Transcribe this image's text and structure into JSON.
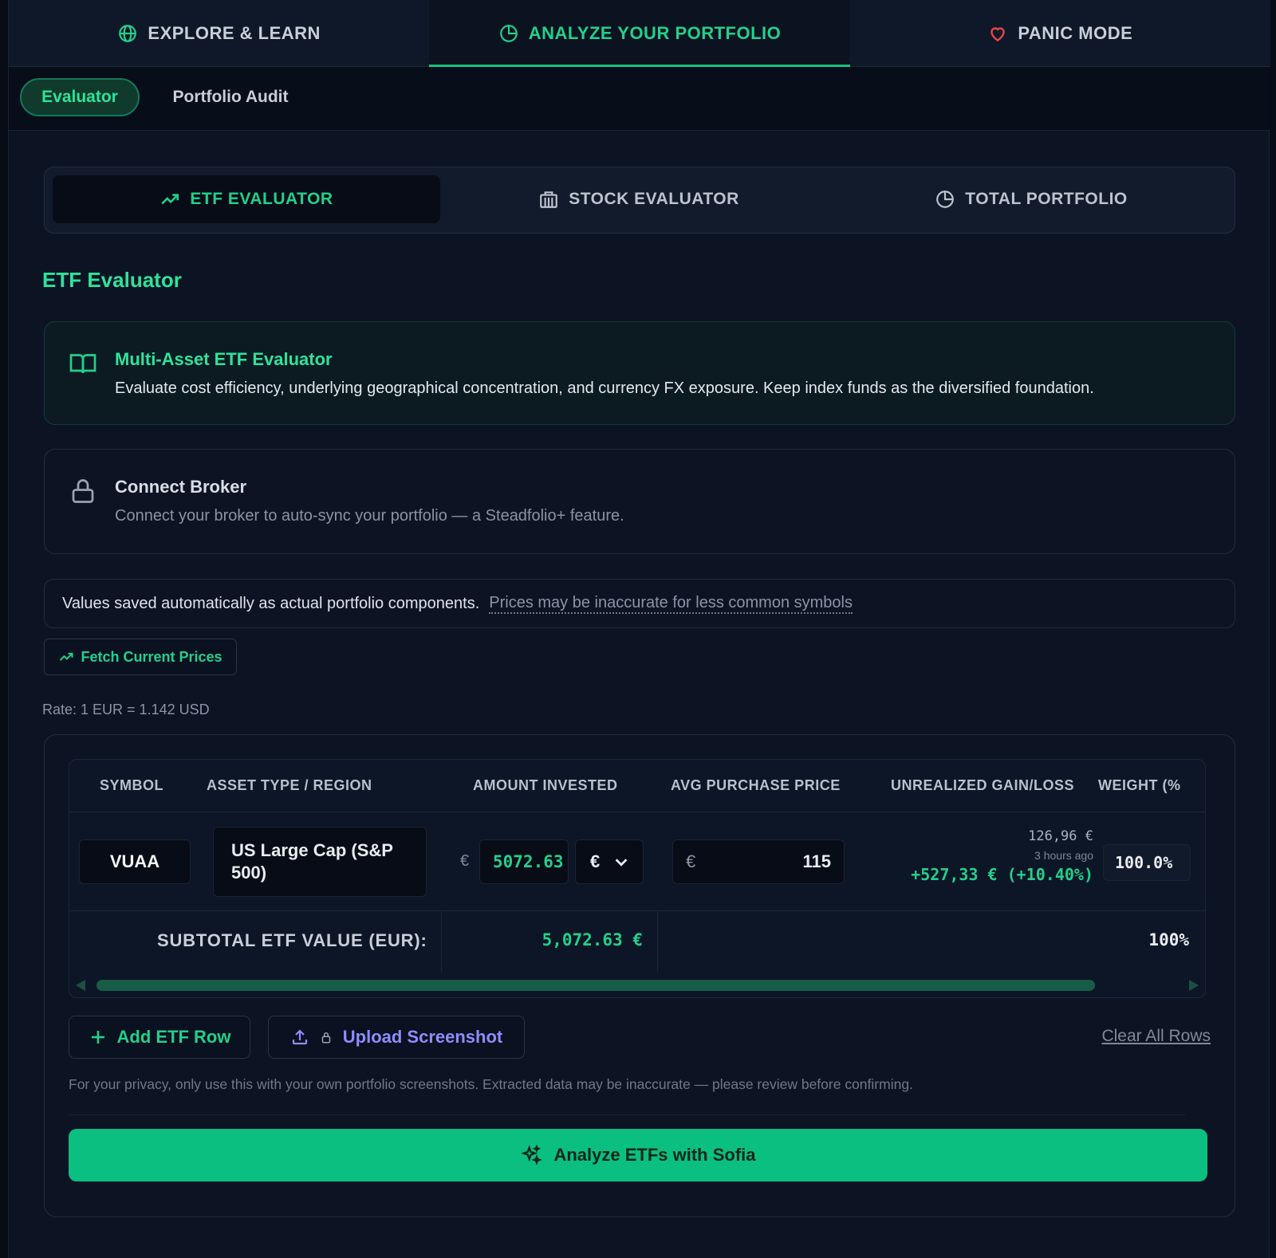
{
  "top_tabs": [
    {
      "label": "EXPLORE & LEARN",
      "icon": "globe-icon"
    },
    {
      "label": "ANALYZE YOUR PORTFOLIO",
      "icon": "pie-chart-icon",
      "active": true
    },
    {
      "label": "PANIC MODE",
      "icon": "heart-icon"
    }
  ],
  "sub_tabs": [
    {
      "label": "Evaluator",
      "active": true
    },
    {
      "label": "Portfolio Audit"
    }
  ],
  "eval_tabs": [
    {
      "label": "ETF EVALUATOR",
      "icon": "trending-up-icon",
      "active": true
    },
    {
      "label": "STOCK EVALUATOR",
      "icon": "building-icon"
    },
    {
      "label": "TOTAL PORTFOLIO",
      "icon": "pie-chart-icon"
    }
  ],
  "section_title": "ETF Evaluator",
  "info_card": {
    "title": "Multi-Asset ETF Evaluator",
    "description": "Evaluate cost efficiency, underlying geographical concentration, and currency FX exposure. Keep index funds as the diversified foundation."
  },
  "broker_card": {
    "title": "Connect Broker",
    "description": "Connect your broker to auto-sync your portfolio — a Steadfolio+ feature."
  },
  "notice": {
    "text": "Values saved automatically as actual portfolio components.",
    "link": "Prices may be inaccurate for less common symbols"
  },
  "fetch_button": "Fetch Current Prices",
  "rate": "Rate: 1 EUR = 1.142 USD",
  "table": {
    "headers": [
      "SYMBOL",
      "ASSET TYPE / REGION",
      "AMOUNT INVESTED",
      "AVG PURCHASE PRICE",
      "UNREALIZED GAIN/LOSS",
      "WEIGHT (%"
    ],
    "row": {
      "symbol": "VUAA",
      "region": "US Large Cap (S&P 500)",
      "amount_currency_label": "€",
      "amount": "5072.63",
      "currency": "€",
      "avg_currency": "€",
      "avg_price": "115",
      "current_value": "126,96 €",
      "updated": "3 hours ago",
      "gain": "+527,33 € (+10.40%)",
      "weight": "100.0%"
    },
    "subtotal_label": "SUBTOTAL ETF VALUE (EUR):",
    "subtotal_value": "5,072.63 €",
    "subtotal_weight": "100%"
  },
  "add_button": "Add ETF Row",
  "upload_button": "Upload Screenshot",
  "clear_link": "Clear All Rows",
  "privacy_note": "For your privacy, only use this with your own portfolio screenshots. Extracted data may be inaccurate — please review before confirming.",
  "analyze_button": "Analyze ETFs with Sofia",
  "colors": {
    "accent": "#22d08a",
    "upload": "#8f8cff",
    "danger": "#e5484d",
    "primary_button": "#0abf7f"
  }
}
